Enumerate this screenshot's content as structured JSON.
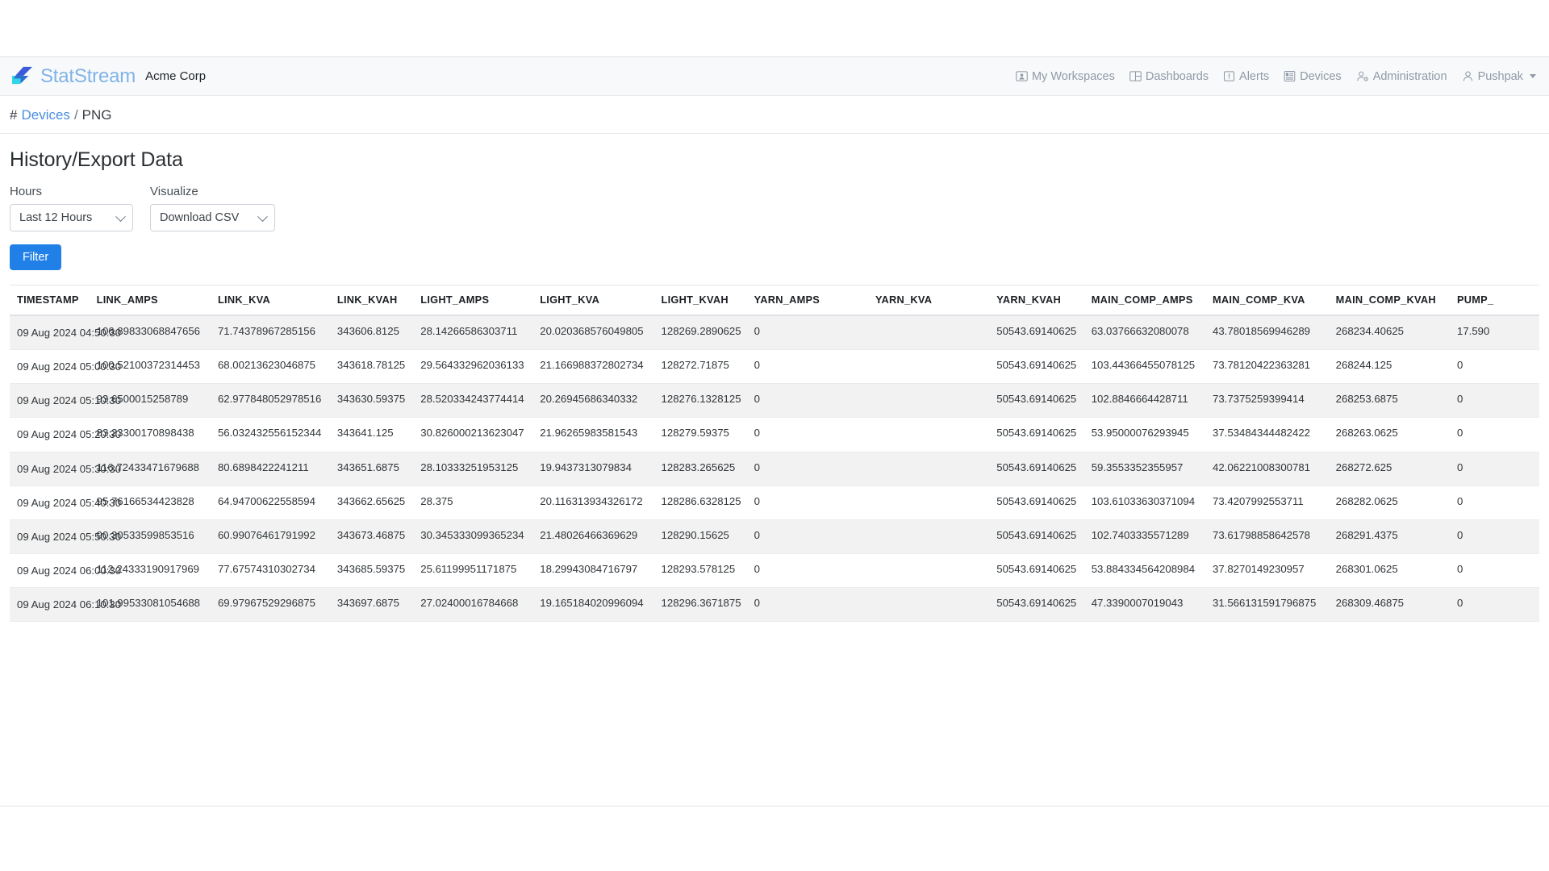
{
  "brand": {
    "name": "StatStream",
    "logo_icon": "statstream-bolt-logo",
    "org": "Acme Corp"
  },
  "nav": {
    "items": [
      {
        "label": "My Workspaces",
        "icon": "person-card-icon"
      },
      {
        "label": "Dashboards",
        "icon": "dashboard-grid-icon"
      },
      {
        "label": "Alerts",
        "icon": "alert-exclamation-icon"
      },
      {
        "label": "Devices",
        "icon": "device-list-icon"
      },
      {
        "label": "Administration",
        "icon": "person-gear-icon"
      }
    ],
    "user": {
      "label": "Pushpak",
      "icon": "person-icon"
    }
  },
  "breadcrumb": {
    "hash": "#",
    "link": "Devices",
    "separator": "/",
    "current": "PNG"
  },
  "page": {
    "title": "History/Export Data"
  },
  "filters": {
    "hours": {
      "label": "Hours",
      "value": "Last 12 Hours",
      "options": [
        "Last 12 Hours"
      ]
    },
    "visualize": {
      "label": "Visualize",
      "value": "Download CSV",
      "options": [
        "Download CSV"
      ]
    },
    "submit_label": "Filter"
  },
  "table": {
    "columns": [
      "TIMESTAMP",
      "LINK_AMPS",
      "LINK_KVA",
      "LINK_KVAH",
      "LIGHT_AMPS",
      "LIGHT_KVA",
      "LIGHT_KVAH",
      "YARN_AMPS",
      "YARN_KVA",
      "YARN_KVAH",
      "MAIN_COMP_AMPS",
      "MAIN_COMP_KVA",
      "MAIN_COMP_KVAH",
      "PUMP_"
    ],
    "rows": [
      [
        "09 Aug 2024 04:50:30",
        "106.89833068847656",
        "71.74378967285156",
        "343606.8125",
        "28.14266586303711",
        "20.020368576049805",
        "128269.2890625",
        "0",
        "",
        "50543.69140625",
        "63.03766632080078",
        "43.78018569946289",
        "268234.40625",
        "17.590"
      ],
      [
        "09 Aug 2024 05:00:30",
        "100.52100372314453",
        "68.00213623046875",
        "343618.78125",
        "29.564332962036133",
        "21.166988372802734",
        "128272.71875",
        "0",
        "",
        "50543.69140625",
        "103.44366455078125",
        "73.78120422363281",
        "268244.125",
        "0"
      ],
      [
        "09 Aug 2024 05:10:30",
        "93.6500015258789",
        "62.977848052978516",
        "343630.59375",
        "28.520334243774414",
        "20.26945686340332",
        "128276.1328125",
        "0",
        "",
        "50543.69140625",
        "102.8846664428711",
        "73.7375259399414",
        "268253.6875",
        "0"
      ],
      [
        "09 Aug 2024 05:20:30",
        "83.23300170898438",
        "56.032432556152344",
        "343641.125",
        "30.826000213623047",
        "21.96265983581543",
        "128279.59375",
        "0",
        "",
        "50543.69140625",
        "53.95000076293945",
        "37.53484344482422",
        "268263.0625",
        "0"
      ],
      [
        "09 Aug 2024 05:30:30",
        "116.72433471679688",
        "80.6898422241211",
        "343651.6875",
        "28.10333251953125",
        "19.9437313079834",
        "128283.265625",
        "0",
        "",
        "50543.69140625",
        "59.3553352355957",
        "42.06221008300781",
        "268272.625",
        "0"
      ],
      [
        "09 Aug 2024 05:40:30",
        "95.76166534423828",
        "64.94700622558594",
        "343662.65625",
        "28.375",
        "20.116313934326172",
        "128286.6328125",
        "0",
        "",
        "50543.69140625",
        "103.61033630371094",
        "73.4207992553711",
        "268282.0625",
        "0"
      ],
      [
        "09 Aug 2024 05:50:30",
        "90.30533599853516",
        "60.99076461791992",
        "343673.46875",
        "30.345333099365234",
        "21.48026466369629",
        "128290.15625",
        "0",
        "",
        "50543.69140625",
        "102.7403335571289",
        "73.61798858642578",
        "268291.4375",
        "0"
      ],
      [
        "09 Aug 2024 06:00:30",
        "112.24333190917969",
        "77.67574310302734",
        "343685.59375",
        "25.61199951171875",
        "18.29943084716797",
        "128293.578125",
        "0",
        "",
        "50543.69140625",
        "53.884334564208984",
        "37.8270149230957",
        "268301.0625",
        "0"
      ],
      [
        "09 Aug 2024 06:10:30",
        "101.99533081054688",
        "69.97967529296875",
        "343697.6875",
        "27.02400016784668",
        "19.165184020996094",
        "128296.3671875",
        "0",
        "",
        "50543.69140625",
        "47.3390007019043",
        "31.566131591796875",
        "268309.46875",
        "0"
      ]
    ]
  },
  "colors": {
    "accent": "#2080e8",
    "link": "#4a8fe0",
    "logo_blue": "#3b5bdb",
    "logo_cyan": "#33d6e8",
    "header_bg": "#f8f9fa",
    "row_alt_bg": "#f2f2f2"
  }
}
